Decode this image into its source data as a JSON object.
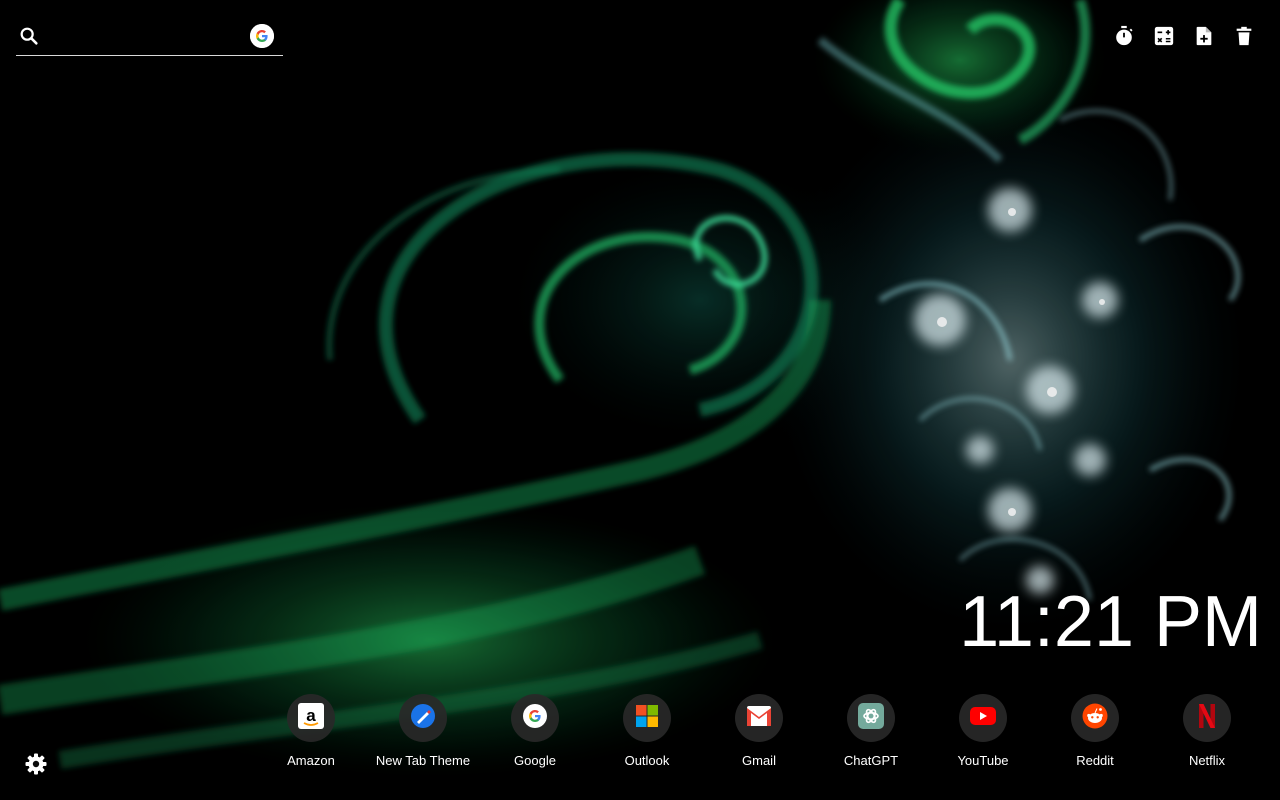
{
  "search": {
    "placeholder": "",
    "value": "",
    "engine_icon": "google-icon"
  },
  "toolbar": {
    "items": [
      {
        "name": "timer-icon",
        "label": "Timer"
      },
      {
        "name": "calculator-icon",
        "label": "Calculator"
      },
      {
        "name": "new-note-icon",
        "label": "New note"
      },
      {
        "name": "trash-icon",
        "label": "Delete"
      }
    ]
  },
  "clock": {
    "time": "11:21 PM"
  },
  "shortcuts": [
    {
      "label": "Amazon",
      "icon": "amazon-icon"
    },
    {
      "label": "New Tab Theme",
      "icon": "new-tab-theme-icon"
    },
    {
      "label": "Google",
      "icon": "google-icon"
    },
    {
      "label": "Outlook",
      "icon": "outlook-icon"
    },
    {
      "label": "Gmail",
      "icon": "gmail-icon"
    },
    {
      "label": "ChatGPT",
      "icon": "chatgpt-icon"
    },
    {
      "label": "YouTube",
      "icon": "youtube-icon"
    },
    {
      "label": "Reddit",
      "icon": "reddit-icon"
    },
    {
      "label": "Netflix",
      "icon": "netflix-icon"
    }
  ],
  "settings": {
    "icon": "gear-icon"
  },
  "colors": {
    "background": "#000000",
    "accent_green": "#1ec85a",
    "accent_teal": "#2aa6a0",
    "text": "#ffffff"
  }
}
